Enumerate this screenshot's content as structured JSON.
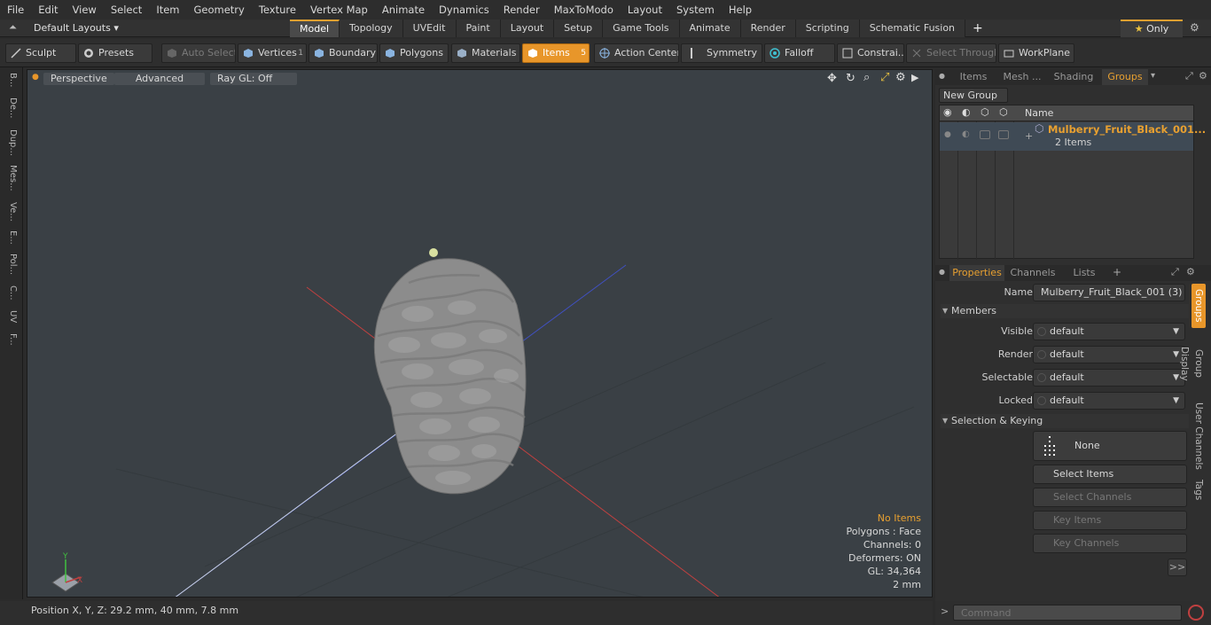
{
  "menu": [
    "File",
    "Edit",
    "View",
    "Select",
    "Item",
    "Geometry",
    "Texture",
    "Vertex Map",
    "Animate",
    "Dynamics",
    "Render",
    "MaxToModo",
    "Layout",
    "System",
    "Help"
  ],
  "layout": {
    "default_layouts": "Default Layouts",
    "tabs": [
      "Model",
      "Topology",
      "UVEdit",
      "Paint",
      "Layout",
      "Setup",
      "Game Tools",
      "Animate",
      "Render",
      "Scripting",
      "Schematic Fusion"
    ],
    "active_tab": "Model",
    "only_label": "Only"
  },
  "toolbar": {
    "sculpt": "Sculpt",
    "presets": "Presets",
    "auto_select": "Auto Select",
    "vertices": "Vertices",
    "vertices_count": "1",
    "boundary": "Boundary",
    "polygons": "Polygons",
    "materials": "Materials",
    "items": "Items",
    "items_count": "5",
    "action_center": "Action Center",
    "symmetry": "Symmetry",
    "falloff": "Falloff",
    "constraints": "Constrai...",
    "select_through": "Select Through",
    "workplane": "WorkPlane"
  },
  "leftbar": [
    "B...",
    "De...",
    "Dup...",
    "Mes...",
    "Ve...",
    "E...",
    "Pol...",
    "C...",
    "UV",
    "F..."
  ],
  "viewport": {
    "perspective": "Perspective",
    "advanced": "Advanced",
    "raygl": "Ray GL: Off",
    "info": {
      "no_items": "No Items",
      "polygons": "Polygons : Face",
      "channels": "Channels: 0",
      "deformers": "Deformers: ON",
      "gl": "GL: 34,364",
      "scale": "2 mm"
    }
  },
  "right_top_tabs": [
    "Items",
    "Mesh ...",
    "Shading",
    "Groups"
  ],
  "right_top_active": "Groups",
  "groups": {
    "new_group": "New Group",
    "name_header": "Name",
    "item_name": "Mulberry_Fruit_Black_001...",
    "item_sub": "2 Items"
  },
  "right_bottom_tabs": [
    "Properties",
    "Channels",
    "Lists"
  ],
  "properties": {
    "name_label": "Name",
    "name_value": "Mulberry_Fruit_Black_001 (3)",
    "members_section": "Members",
    "visible_label": "Visible",
    "visible_value": "default",
    "render_label": "Render",
    "render_value": "default",
    "selectable_label": "Selectable",
    "selectable_value": "default",
    "locked_label": "Locked",
    "locked_value": "default",
    "selection_section": "Selection & Keying",
    "none_label": "None",
    "select_items": "Select Items",
    "select_channels": "Select Channels",
    "key_items": "Key Items",
    "key_channels": "Key Channels",
    "more": ">>"
  },
  "side_tabs": [
    "Groups",
    "Group Display",
    "User Channels",
    "Tags"
  ],
  "status": {
    "position": "Position X, Y, Z:  29.2 mm, 40 mm, 7.8 mm"
  },
  "command": {
    "placeholder": "Command"
  },
  "colors": {
    "accent": "#e8962a",
    "viewport_bg": "#3a4045",
    "group_name": "#e8a030"
  }
}
